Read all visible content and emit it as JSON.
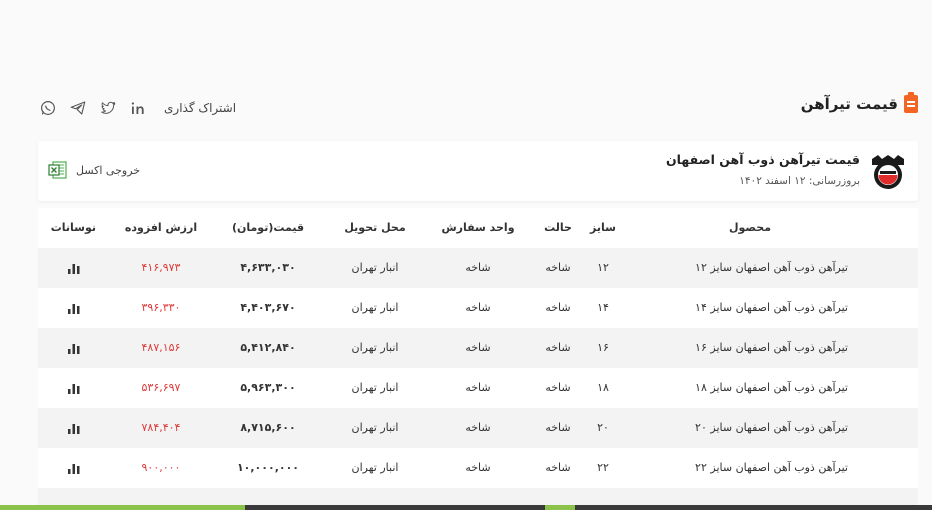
{
  "header": {
    "title": "قیمت تیرآهن",
    "share_label": "اشتراک گذاری"
  },
  "product_card": {
    "name": "قیمت تیرآهن ذوب آهن اصفهان",
    "updated": "بروزرسانی: ۱۲ اسفند ۱۴۰۲",
    "excel_label": "خروجی اکسل"
  },
  "table": {
    "headers": {
      "product": "محصول",
      "size": "سایز",
      "state": "حالت",
      "unit": "واحد سفارش",
      "location": "محل تحویل",
      "price": "قیمت(تومان)",
      "vat": "ارزش افزوده",
      "chart": "نوسانات"
    },
    "rows": [
      {
        "product": "تیرآهن ذوب آهن اصفهان سایز ۱۲",
        "size": "۱۲",
        "state": "شاخه",
        "unit": "شاخه",
        "location": "انبار تهران",
        "price": "۴,۶۳۳,۰۳۰",
        "vat": "۴۱۶,۹۷۳"
      },
      {
        "product": "تیرآهن ذوب آهن اصفهان سایز ۱۴",
        "size": "۱۴",
        "state": "شاخه",
        "unit": "شاخه",
        "location": "انبار تهران",
        "price": "۴,۴۰۳,۶۷۰",
        "vat": "۳۹۶,۳۳۰"
      },
      {
        "product": "تیرآهن ذوب آهن اصفهان سایز ۱۶",
        "size": "۱۶",
        "state": "شاخه",
        "unit": "شاخه",
        "location": "انبار تهران",
        "price": "۵,۴۱۲,۸۴۰",
        "vat": "۴۸۷,۱۵۶"
      },
      {
        "product": "تیرآهن ذوب آهن اصفهان سایز ۱۸",
        "size": "۱۸",
        "state": "شاخه",
        "unit": "شاخه",
        "location": "انبار تهران",
        "price": "۵,۹۶۳,۳۰۰",
        "vat": "۵۳۶,۶۹۷"
      },
      {
        "product": "تیرآهن ذوب آهن اصفهان سایز ۲۰",
        "size": "۲۰",
        "state": "شاخه",
        "unit": "شاخه",
        "location": "انبار تهران",
        "price": "۸,۷۱۵,۶۰۰",
        "vat": "۷۸۴,۴۰۴"
      },
      {
        "product": "تیرآهن ذوب آهن اصفهان سایز ۲۲",
        "size": "۲۲",
        "state": "شاخه",
        "unit": "شاخه",
        "location": "انبار تهران",
        "price": "۱۰,۰۰۰,۰۰۰",
        "vat": "۹۰۰,۰۰۰"
      }
    ]
  },
  "colors": {
    "accent": "#f26522",
    "vat_text": "#e03a3a",
    "row_alt": "#f3f3f3"
  },
  "icons": {
    "title": "clipboard-icon",
    "social": [
      "whatsapp-icon",
      "telegram-icon",
      "twitter-icon",
      "linkedin-icon"
    ],
    "excel": "excel-icon",
    "chart": "bar-chart-icon"
  }
}
